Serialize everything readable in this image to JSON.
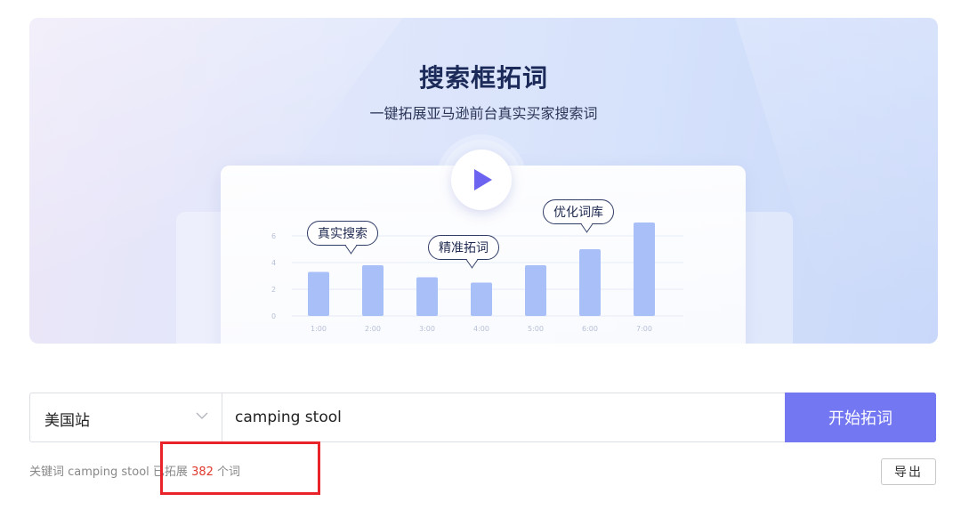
{
  "hero": {
    "title": "搜索框拓词",
    "subtitle": "一键拓展亚马逊前台真实买家搜索词",
    "play_icon": "play-icon",
    "illustration": {
      "bubbles": [
        "真实搜索",
        "精准拓词",
        "优化词库"
      ],
      "y_ticks": [
        "0",
        "2",
        "4",
        "6"
      ],
      "x_ticks": [
        "1:00",
        "2:00",
        "3:00",
        "4:00",
        "5:00",
        "6:00",
        "7:00"
      ],
      "bar_values": [
        3.3,
        3.8,
        2.9,
        2.5,
        3.8,
        5.0,
        7.0
      ],
      "y_max": 8,
      "bar_color": "#a9bff8"
    }
  },
  "search": {
    "site_label": "美国站",
    "site_chevron": "chevron-down-icon",
    "keyword_value": "camping stool",
    "start_label": "开始拓词",
    "accent_color": "#7377f2"
  },
  "status": {
    "prefix": "关键词 camping stool 已拓展",
    "count": "382",
    "suffix": "个词",
    "count_color": "#e0392d"
  },
  "export_label": "导出"
}
